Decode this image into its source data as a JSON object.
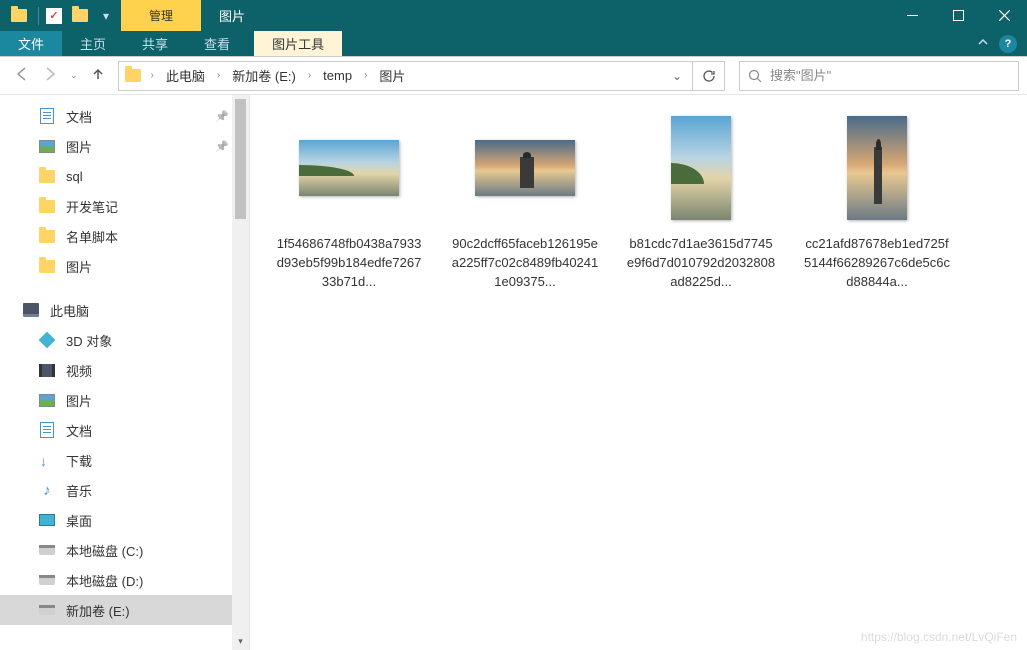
{
  "titlebar": {
    "manage_label": "管理",
    "title": "图片"
  },
  "ribbon": {
    "file": "文件",
    "home": "主页",
    "share": "共享",
    "view": "查看",
    "picture_tools": "图片工具"
  },
  "breadcrumb": {
    "items": [
      "此电脑",
      "新加卷 (E:)",
      "temp",
      "图片"
    ]
  },
  "search": {
    "placeholder": "搜索\"图片\""
  },
  "sidebar": {
    "quick": [
      {
        "label": "文档",
        "icon": "doc",
        "pinned": true
      },
      {
        "label": "图片",
        "icon": "pic",
        "pinned": true
      },
      {
        "label": "sql",
        "icon": "folder",
        "pinned": false
      },
      {
        "label": "开发笔记",
        "icon": "folder",
        "pinned": false
      },
      {
        "label": "名单脚本",
        "icon": "folder",
        "pinned": false
      },
      {
        "label": "图片",
        "icon": "folder",
        "pinned": false
      }
    ],
    "this_pc": "此电脑",
    "pc_items": [
      {
        "label": "3D 对象",
        "icon": "obj3d"
      },
      {
        "label": "视频",
        "icon": "video"
      },
      {
        "label": "图片",
        "icon": "pic"
      },
      {
        "label": "文档",
        "icon": "doc"
      },
      {
        "label": "下载",
        "icon": "download"
      },
      {
        "label": "音乐",
        "icon": "music"
      },
      {
        "label": "桌面",
        "icon": "desktop"
      },
      {
        "label": "本地磁盘 (C:)",
        "icon": "disk"
      },
      {
        "label": "本地磁盘 (D:)",
        "icon": "disk"
      },
      {
        "label": "新加卷 (E:)",
        "icon": "disk",
        "selected": true
      }
    ]
  },
  "files": [
    {
      "name": "1f54686748fb0438a7933d93eb5f99b184edfe726733b71d...",
      "orientation": "landscape",
      "style": "sky",
      "hill": true
    },
    {
      "name": "90c2dcff65faceb126195ea225ff7c02c8489fb402411e09375...",
      "orientation": "landscape",
      "style": "sunset",
      "tower": true
    },
    {
      "name": "b81cdc7d1ae3615d7745e9f6d7d010792d2032808ad8225d...",
      "orientation": "portrait",
      "style": "sky",
      "hill": true
    },
    {
      "name": "cc21afd87678eb1ed725f5144f66289267c6de5c6cd88844a...",
      "orientation": "portrait",
      "style": "sunset",
      "tower": true
    }
  ],
  "watermark": "https://blog.csdn.net/LvQiFen"
}
